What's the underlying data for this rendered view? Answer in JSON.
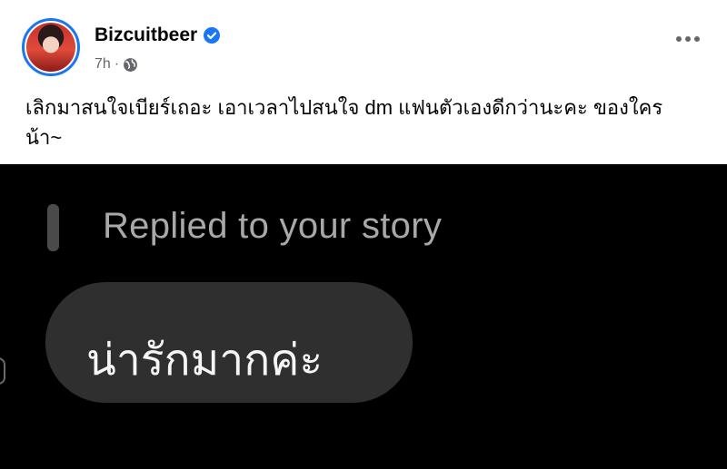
{
  "post": {
    "author": "Bizcuitbeer",
    "time": "7h",
    "separator": "·",
    "text": "เลิกมาสนใจเบียร์เถอะ เอาเวลาไปสนใจ dm แฟนตัวเองดีกว่านะคะ ของใคร น้า~",
    "icons": {
      "verified": "verified-badge-icon",
      "audience": "globe-icon",
      "menu": "more-options-icon"
    }
  },
  "story": {
    "replied_label": "Replied to your story",
    "message": "น่ารักมากค่ะ"
  },
  "colors": {
    "verified": "#1877f2",
    "meta": "#65676b",
    "story_bg": "#000000",
    "bubble": "#2f2f2f"
  }
}
